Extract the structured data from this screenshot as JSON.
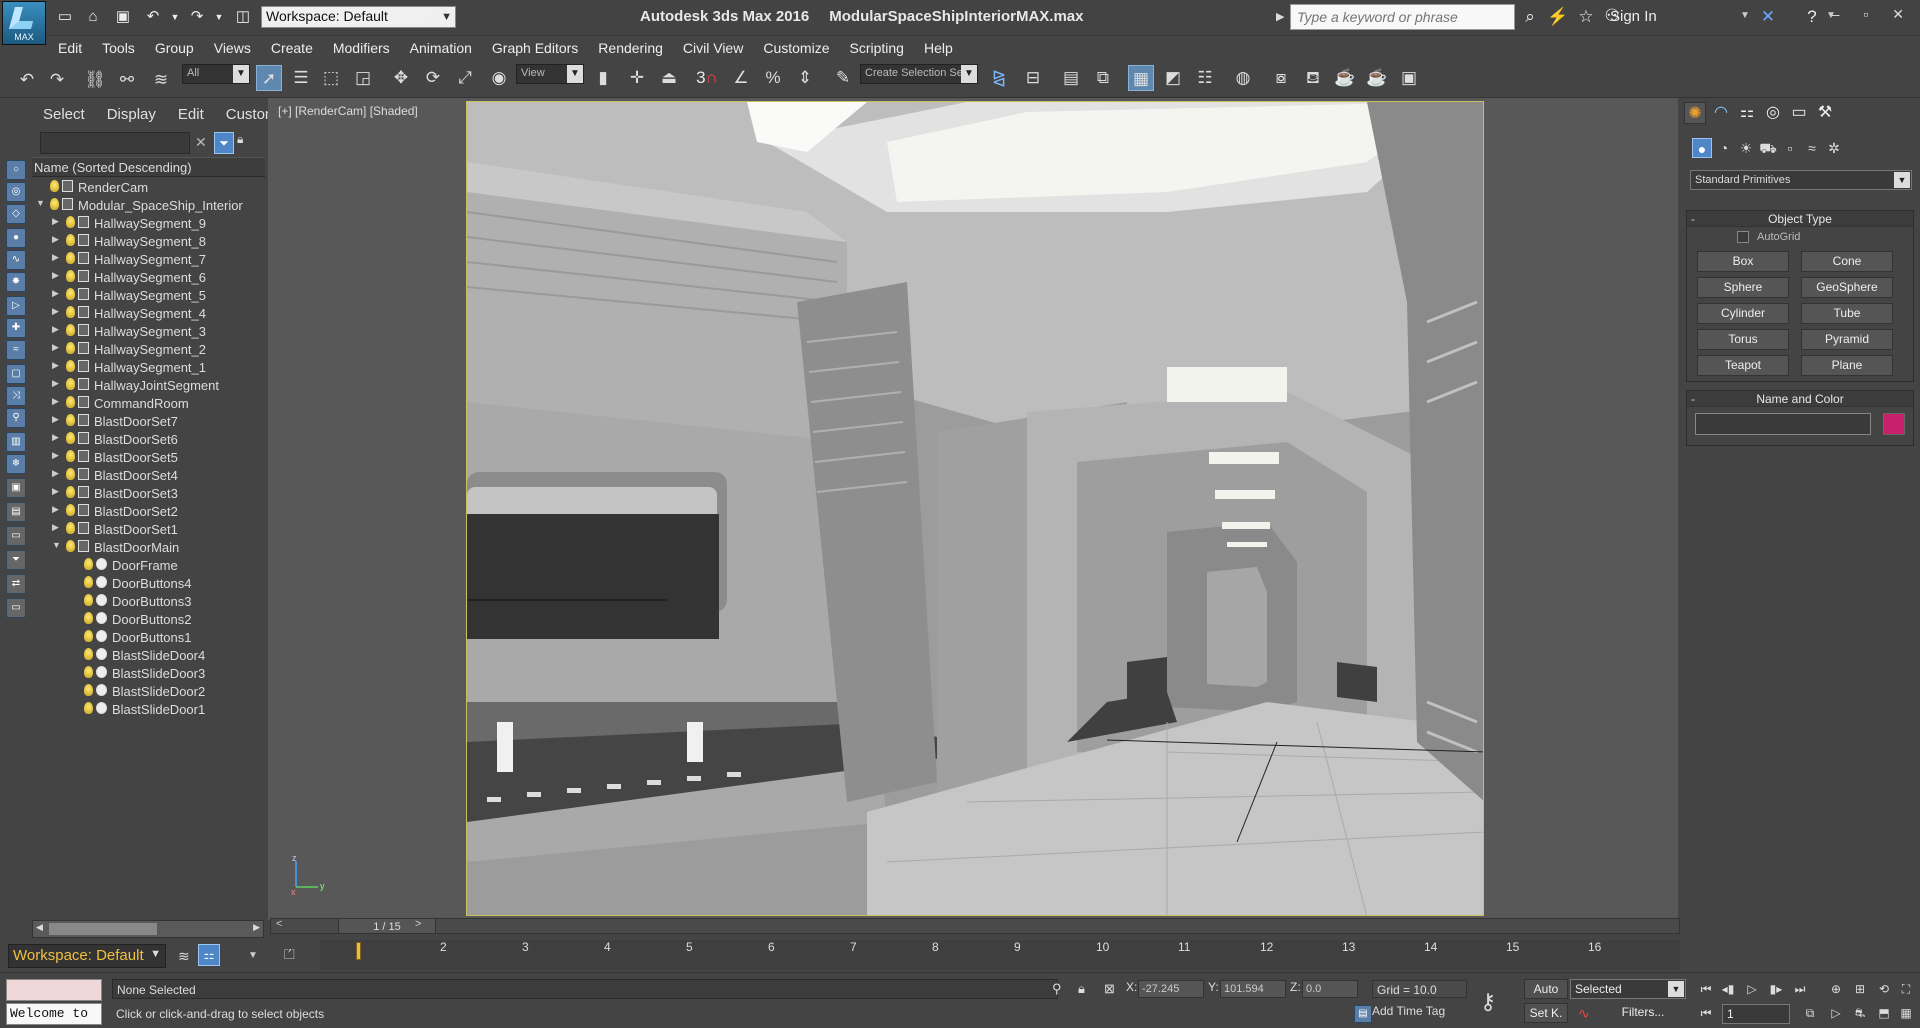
{
  "app": {
    "title": "Autodesk 3ds Max 2016",
    "file": "ModularSpaceShipInteriorMAX.max",
    "logo_text": "MAX"
  },
  "quick_access": {
    "workspace": "Workspace: Default",
    "search_placeholder": "Type a keyword or phrase",
    "signin": "Sign In",
    "window_controls": "‒ ▫ ✕"
  },
  "menu": [
    "Edit",
    "Tools",
    "Group",
    "Views",
    "Create",
    "Modifiers",
    "Animation",
    "Graph Editors",
    "Rendering",
    "Civil View",
    "Customize",
    "Scripting",
    "Help"
  ],
  "toolbar": {
    "selection_filter": "All",
    "ref_coord": "View",
    "named_selection": "Create Selection Se",
    "snap_label": "3"
  },
  "explorer": {
    "tabs": [
      "Select",
      "Display",
      "Edit",
      "Customize"
    ],
    "column_header": "Name (Sorted Descending)",
    "items": [
      {
        "name": "RenderCam",
        "level": 0,
        "expand": "",
        "kind": "camera"
      },
      {
        "name": "Modular_SpaceShip_Interior",
        "level": 0,
        "expand": "▼",
        "kind": "group"
      },
      {
        "name": "HallwaySegment_9",
        "level": 1,
        "expand": "▶",
        "kind": "group"
      },
      {
        "name": "HallwaySegment_8",
        "level": 1,
        "expand": "▶",
        "kind": "group"
      },
      {
        "name": "HallwaySegment_7",
        "level": 1,
        "expand": "▶",
        "kind": "group"
      },
      {
        "name": "HallwaySegment_6",
        "level": 1,
        "expand": "▶",
        "kind": "group"
      },
      {
        "name": "HallwaySegment_5",
        "level": 1,
        "expand": "▶",
        "kind": "group"
      },
      {
        "name": "HallwaySegment_4",
        "level": 1,
        "expand": "▶",
        "kind": "group"
      },
      {
        "name": "HallwaySegment_3",
        "level": 1,
        "expand": "▶",
        "kind": "group"
      },
      {
        "name": "HallwaySegment_2",
        "level": 1,
        "expand": "▶",
        "kind": "group"
      },
      {
        "name": "HallwaySegment_1",
        "level": 1,
        "expand": "▶",
        "kind": "group"
      },
      {
        "name": "HallwayJointSegment",
        "level": 1,
        "expand": "▶",
        "kind": "group"
      },
      {
        "name": "CommandRoom",
        "level": 1,
        "expand": "▶",
        "kind": "group"
      },
      {
        "name": "BlastDoorSet7",
        "level": 1,
        "expand": "▶",
        "kind": "group"
      },
      {
        "name": "BlastDoorSet6",
        "level": 1,
        "expand": "▶",
        "kind": "group"
      },
      {
        "name": "BlastDoorSet5",
        "level": 1,
        "expand": "▶",
        "kind": "group"
      },
      {
        "name": "BlastDoorSet4",
        "level": 1,
        "expand": "▶",
        "kind": "group"
      },
      {
        "name": "BlastDoorSet3",
        "level": 1,
        "expand": "▶",
        "kind": "group"
      },
      {
        "name": "BlastDoorSet2",
        "level": 1,
        "expand": "▶",
        "kind": "group"
      },
      {
        "name": "BlastDoorSet1",
        "level": 1,
        "expand": "▶",
        "kind": "group"
      },
      {
        "name": "BlastDoorMain",
        "level": 1,
        "expand": "▼",
        "kind": "group"
      },
      {
        "name": "DoorFrame",
        "level": 2,
        "expand": "",
        "kind": "mesh"
      },
      {
        "name": "DoorButtons4",
        "level": 2,
        "expand": "",
        "kind": "mesh"
      },
      {
        "name": "DoorButtons3",
        "level": 2,
        "expand": "",
        "kind": "mesh"
      },
      {
        "name": "DoorButtons2",
        "level": 2,
        "expand": "",
        "kind": "mesh"
      },
      {
        "name": "DoorButtons1",
        "level": 2,
        "expand": "",
        "kind": "mesh"
      },
      {
        "name": "BlastSlideDoor4",
        "level": 2,
        "expand": "",
        "kind": "mesh"
      },
      {
        "name": "BlastSlideDoor3",
        "level": 2,
        "expand": "",
        "kind": "mesh"
      },
      {
        "name": "BlastSlideDoor2",
        "level": 2,
        "expand": "",
        "kind": "mesh"
      },
      {
        "name": "BlastSlideDoor1",
        "level": 2,
        "expand": "",
        "kind": "mesh"
      }
    ],
    "workspace": "Workspace: Default"
  },
  "viewport": {
    "label": "[+] [RenderCam] [Shaded]"
  },
  "command_panel": {
    "category": "Standard Primitives",
    "object_type_title": "Object Type",
    "autogrid": "AutoGrid",
    "primitives": [
      "Box",
      "Cone",
      "Sphere",
      "GeoSphere",
      "Cylinder",
      "Tube",
      "Torus",
      "Pyramid",
      "Teapot",
      "Plane"
    ],
    "name_color_title": "Name and Color",
    "color": "#c8206a"
  },
  "timeline": {
    "frame_label": "1 / 15",
    "ticks": [
      "2",
      "3",
      "4",
      "5",
      "6",
      "7",
      "8",
      "9",
      "10",
      "11",
      "12",
      "13",
      "14",
      "15",
      "16"
    ]
  },
  "status": {
    "maxscript": "Welcome to",
    "selection": "None Selected",
    "prompt": "Click or click-and-drag to select objects",
    "x_label": "X:",
    "x": "-27.245",
    "y_label": "Y:",
    "y": "101.594",
    "z_label": "Z:",
    "z": "0.0",
    "grid": "Grid = 10.0",
    "add_time_tag": "Add Time Tag",
    "auto": "Auto",
    "set_key": "Set K.",
    "key_filter": "Selected",
    "filters": "Filters...",
    "current_frame": "1"
  }
}
